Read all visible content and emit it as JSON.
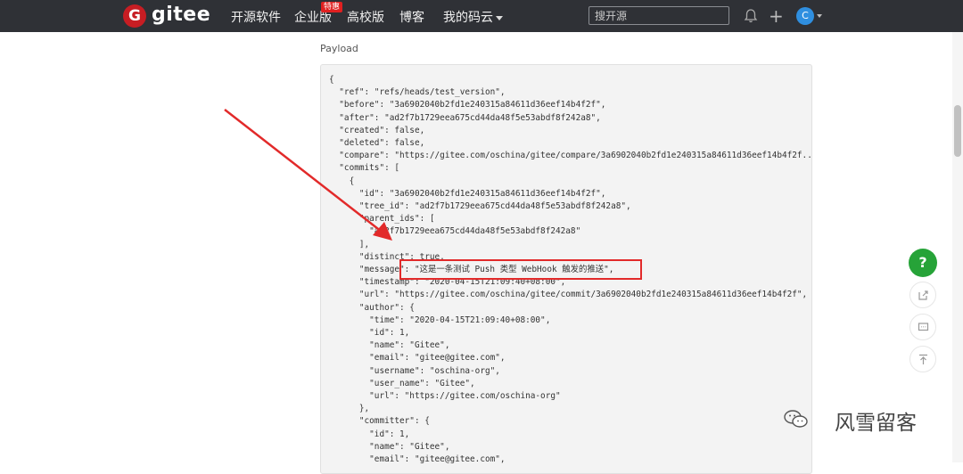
{
  "brand": {
    "logo_letter": "G",
    "name": "gitee",
    "color": "#c71d23"
  },
  "nav": {
    "items": [
      "开源软件",
      "企业版",
      "高校版",
      "博客",
      "我的码云"
    ],
    "hot_badge": "特惠"
  },
  "search": {
    "placeholder": "搜开源"
  },
  "user": {
    "avatar_initial": "C"
  },
  "section": {
    "title": "Payload"
  },
  "payload_lines": [
    "{",
    "  \"ref\": \"refs/heads/test_version\",",
    "  \"before\": \"3a6902040b2fd1e240315a84611d36eef14b4f2f\",",
    "  \"after\": \"ad2f7b1729eea675cd44da48f5e53abdf8f242a8\",",
    "  \"created\": false,",
    "  \"deleted\": false,",
    "  \"compare\": \"https://gitee.com/oschina/gitee/compare/3a6902040b2fd1e240315a84611d36eef14b4f2f..",
    "  \"commits\": [",
    "    {",
    "      \"id\": \"3a6902040b2fd1e240315a84611d36eef14b4f2f\",",
    "      \"tree_id\": \"ad2f7b1729eea675cd44da48f5e53abdf8f242a8\",",
    "      \"parent_ids\": [",
    "        \"ad2f7b1729eea675cd44da48f5e53abdf8f242a8\"",
    "      ],",
    "      \"distinct\": true,",
    "      \"message\": \"这是一条测试 Push 类型 WebHook 触发的推送\",",
    "      \"timestamp\": \"2020-04-15T21:09:40+08:00\",",
    "      \"url\": \"https://gitee.com/oschina/gitee/commit/3a6902040b2fd1e240315a84611d36eef14b4f2f\",",
    "      \"author\": {",
    "        \"time\": \"2020-04-15T21:09:40+08:00\",",
    "        \"id\": 1,",
    "        \"name\": \"Gitee\",",
    "        \"email\": \"gitee@gitee.com\",",
    "        \"username\": \"oschina-org\",",
    "        \"user_name\": \"Gitee\",",
    "        \"url\": \"https://gitee.com/oschina-org\"",
    "      },",
    "      \"committer\": {",
    "        \"id\": 1,",
    "        \"name\": \"Gitee\",",
    "        \"email\": \"gitee@gitee.com\","
  ],
  "side_buttons": {
    "help_label": "?"
  },
  "watermark": {
    "text": "风雪留客"
  },
  "colors": {
    "annotation": "#e22a2a",
    "help": "#26a338",
    "topbar": "#2f3136"
  }
}
